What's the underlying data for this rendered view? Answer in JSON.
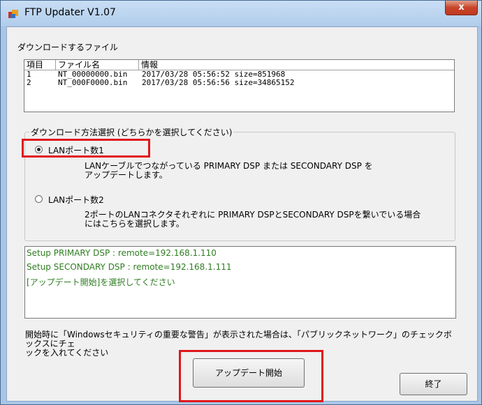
{
  "window": {
    "title": "FTP Updater V1.07",
    "close_label": "x"
  },
  "download_section": {
    "label": "ダウンロードするファイル"
  },
  "file_list": {
    "columns": [
      "項目",
      "ファイル名",
      "情報"
    ],
    "rows": [
      {
        "index": "1",
        "filename": "NT_00000000.bin",
        "info": "2017/03/28 05:56:52 size=851968"
      },
      {
        "index": "2",
        "filename": "NT_000F0000.bin",
        "info": "2017/03/28 05:56:56 size=34865152"
      }
    ]
  },
  "method_group": {
    "caption": "ダウンロード方法選択 (どちらかを選択してください)",
    "options": [
      {
        "label": "LANポート数1",
        "selected": true,
        "description_line1": "LANケーブルでつながっている PRIMARY DSP または SECONDARY DSP を",
        "description_line2": "アップデートします。"
      },
      {
        "label": "LANポート数2",
        "selected": false,
        "description_line1": "2ポートのLANコネクタそれぞれに PRIMARY DSPとSECONDARY DSPを繋いでいる場合",
        "description_line2": "にはこちらを選択します。"
      }
    ]
  },
  "log": {
    "lines": [
      "Setup PRIMARY DSP      : remote=192.168.1.110",
      "Setup SECONDARY DSP  : remote=192.168.1.111",
      "[アップデート開始]を選択してください"
    ]
  },
  "notice": {
    "line1": "開始時に「Windowsセキュリティの重要な警告」が表示された場合は、「パブリックネットワーク」のチェックボックスにチェ",
    "line2": "ックを入れてください"
  },
  "buttons": {
    "start_label": "アップデート開始",
    "exit_label": "終了"
  },
  "colors": {
    "highlight": "#e0161b",
    "log_text": "#2e7d20",
    "title_bar": "#b1cdeb"
  }
}
